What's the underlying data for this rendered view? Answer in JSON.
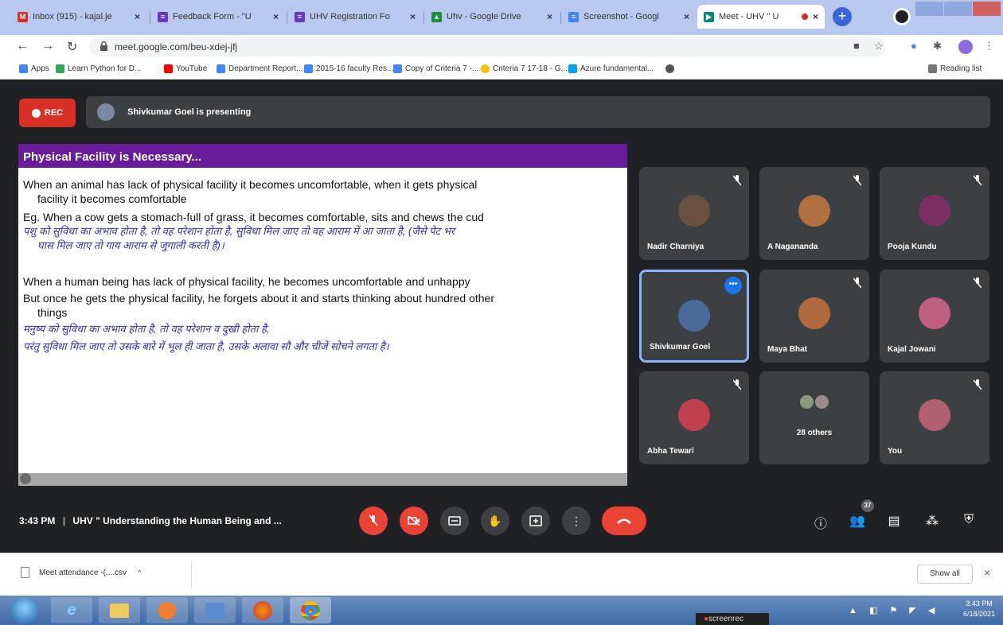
{
  "browser": {
    "tabs": [
      {
        "label": "Inbox (915) - kajal.je",
        "favicon": "gmail-icon",
        "color": "#d93025"
      },
      {
        "label": "Feedback Form - \"U",
        "favicon": "forms-icon",
        "color": "#673ab7"
      },
      {
        "label": "UHV Registration Fo",
        "favicon": "forms-icon",
        "color": "#673ab7"
      },
      {
        "label": "Uhv - Google Drive",
        "favicon": "drive-icon",
        "color": "#1e8e3e"
      },
      {
        "label": "Screenshot - Googl",
        "favicon": "docs-icon",
        "color": "#4285f4"
      },
      {
        "label": "Meet - UHV \" U",
        "favicon": "meet-icon",
        "color": "#00897b"
      }
    ],
    "url": "meet.google.com/beu-xdej-jfj",
    "bookmarks": [
      {
        "label": "Apps",
        "color": "#4285f4"
      },
      {
        "label": "Learn Python for D...",
        "color": "#34a853"
      },
      {
        "label": "YouTube",
        "color": "#ff0000"
      },
      {
        "label": "Department Report...",
        "color": "#4285f4"
      },
      {
        "label": "2015-16 faculty Res...",
        "color": "#4285f4"
      },
      {
        "label": "Copy of Criteria 7 -...",
        "color": "#4285f4"
      },
      {
        "label": "Criteria 7 17-18 - G...",
        "color": "#fbbc05"
      },
      {
        "label": "Azure fundamental...",
        "color": "#00a4ef"
      }
    ],
    "reading_list": "Reading list"
  },
  "meet": {
    "rec_label": "REC",
    "presenting_banner": "Shivkumar Goel is presenting",
    "slide": {
      "title": "Physical Facility is Necessary...",
      "para1_line1": "When an animal has lack of physical facility it becomes uncomfortable, when it gets physical",
      "para1_line2": "facility it becomes comfortable",
      "para1_line3": "Eg. When a cow gets a stomach-full of grass, it becomes comfortable, sits and chews the cud",
      "hindi1_line1": "पशु को सुविधा का अभाव होता है, तो वह परेशान होता है, सुविधा मिल जाए तो वह आराम में आ जाता है, (जैसे पेट भर",
      "hindi1_line2": "घास मिल जाए तो गाय आराम से जुगाली करती है)।",
      "para2_line1": "When a human being has lack of physical facility, he becomes uncomfortable and unhappy",
      "para2_line2": "But once he gets the physical facility, he forgets about it and starts thinking about hundred other",
      "para2_line3": "things",
      "hindi2_line1": "मनुष्य को सुविधा का अभाव होता है, तो वह परेशान व दुखी होता है,",
      "hindi2_line2": "परंतु सुविधा मिल जाए तो उसके बारे में भूल ही जाता है, उसके अलावा सौ और चीजें सोचने लगता है।"
    },
    "participants": [
      {
        "name": "Nadir Charniya",
        "color": "#6a5040"
      },
      {
        "name": "A Nagananda",
        "color": "#b07040"
      },
      {
        "name": "Pooja Kundu",
        "color": "#7a3060"
      },
      {
        "name": "Shivkumar Goel",
        "color": "#4a6a9a",
        "active": true
      },
      {
        "name": "Maya Bhat",
        "color": "#b06a40"
      },
      {
        "name": "Kajal Jowani",
        "color": "#c06080"
      },
      {
        "name": "Abha Tewari",
        "color": "#c04050"
      },
      {
        "name": "28 others",
        "color": "#888"
      },
      {
        "name": "You",
        "color": "#b06070"
      }
    ],
    "time": "3:43 PM",
    "meeting_title": "UHV \" Understanding the Human Being and ...",
    "participant_count": "37"
  },
  "downloads": {
    "file": "Meet attendance -(....csv",
    "show_all": "Show all"
  },
  "taskbar": {
    "screenrec": "screenrec",
    "time": "3:43 PM",
    "date": "6/18/2021"
  }
}
